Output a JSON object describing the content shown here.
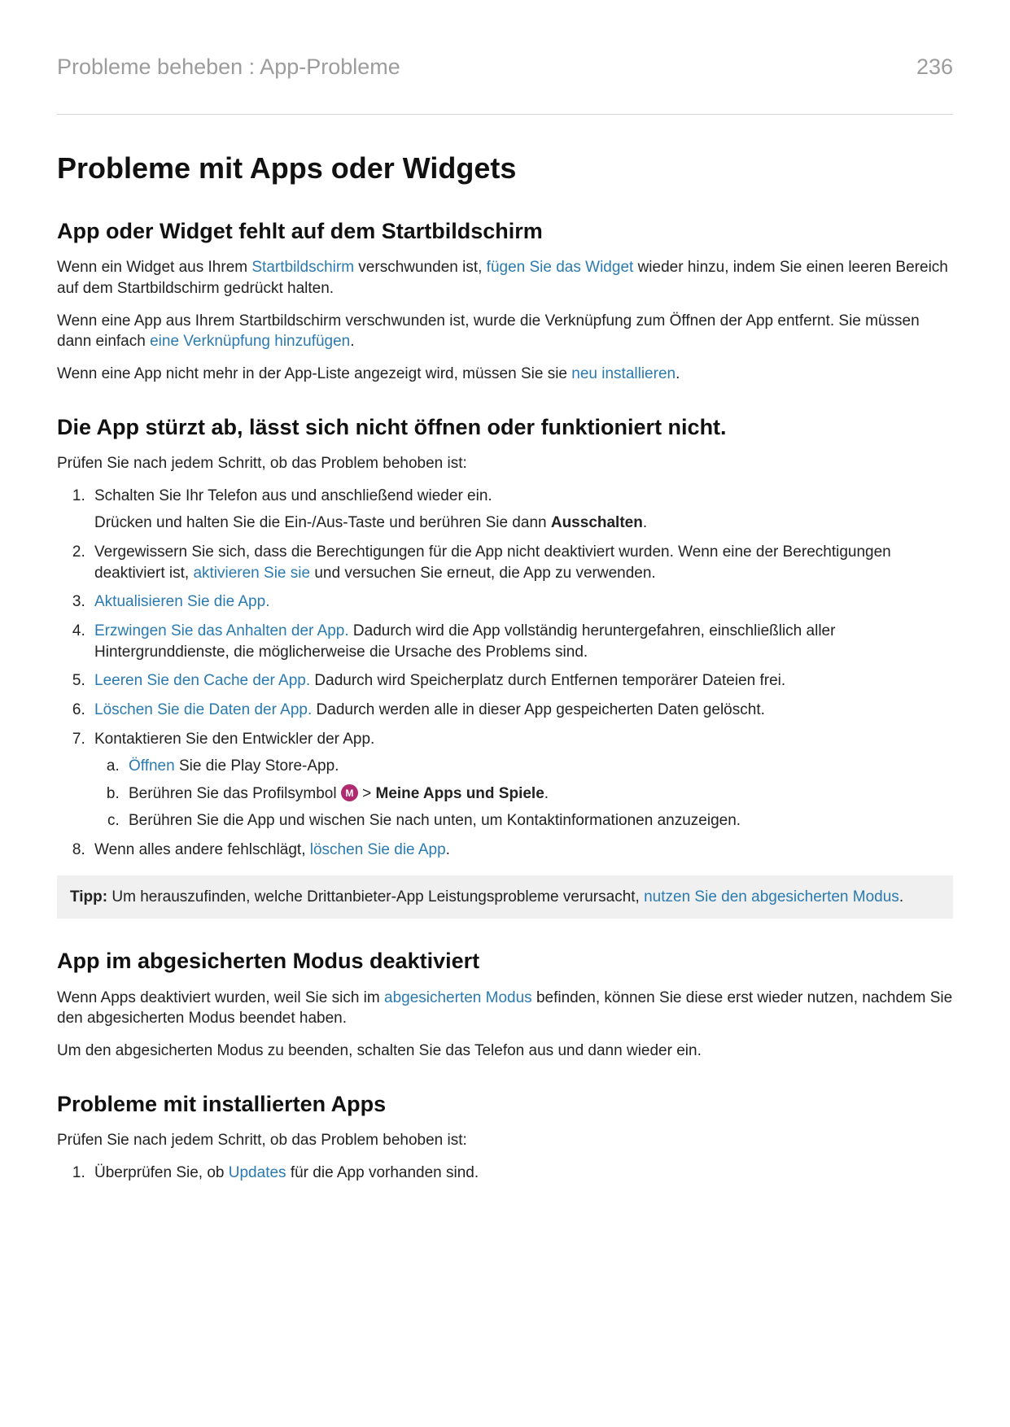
{
  "header": {
    "breadcrumb": "Probleme beheben : App-Probleme",
    "page_number": "236"
  },
  "title": "Probleme mit Apps oder Widgets",
  "s1": {
    "heading": "App oder Widget fehlt auf dem Startbildschirm",
    "p1_a": "Wenn ein Widget aus Ihrem ",
    "p1_link1": "Startbildschirm",
    "p1_b": " verschwunden ist, ",
    "p1_link2": "fügen Sie das Widget",
    "p1_c": " wieder hinzu, indem Sie einen leeren Bereich auf dem Startbildschirm gedrückt halten.",
    "p2_a": "Wenn eine App aus Ihrem Startbildschirm verschwunden ist, wurde die Verknüpfung zum Öffnen der App entfernt. Sie müssen dann einfach ",
    "p2_link": "eine Verknüpfung hinzufügen",
    "p2_b": ".",
    "p3_a": "Wenn eine App nicht mehr in der App-Liste angezeigt wird, müssen Sie sie ",
    "p3_link": "neu installieren",
    "p3_b": "."
  },
  "s2": {
    "heading": "Die App stürzt ab, lässt sich nicht öffnen oder funktioniert nicht.",
    "intro": "Prüfen Sie nach jedem Schritt, ob das Problem behoben ist:",
    "li1_p1": "Schalten Sie Ihr Telefon aus und anschließend wieder ein.",
    "li1_p2_a": "Drücken und halten Sie die Ein-/Aus-Taste und berühren Sie dann ",
    "li1_p2_bold": "Ausschalten",
    "li1_p2_b": ".",
    "li2_a": "Vergewissern Sie sich, dass die Berechtigungen für die App nicht deaktiviert wurden. Wenn eine der Berechtigungen deaktiviert ist, ",
    "li2_link": "aktivieren Sie sie",
    "li2_b": " und versuchen Sie erneut, die App zu verwenden.",
    "li3_link": "Aktualisieren Sie die App.",
    "li4_link": "Erzwingen Sie das Anhalten der App.",
    "li4_b": " Dadurch wird die App vollständig heruntergefahren, einschließlich aller Hintergrunddienste, die möglicherweise die Ursache des Problems sind.",
    "li5_link": "Leeren Sie den Cache der App.",
    "li5_b": " Dadurch wird Speicherplatz durch Entfernen temporärer Dateien frei.",
    "li6_link": "Löschen Sie die Daten der App.",
    "li6_b": " Dadurch werden alle in dieser App gespeicherten Daten gelöscht.",
    "li7_text": "Kontaktieren Sie den Entwickler der App.",
    "li7a_link": "Öffnen",
    "li7a_b": " Sie die Play Store-App.",
    "li7b_a": "Berühren Sie das Profilsymbol ",
    "li7b_icon_letter": "M",
    "li7b_mid": " > ",
    "li7b_bold": "Meine Apps und Spiele",
    "li7b_end": ".",
    "li7c": "Berühren Sie die App und wischen Sie nach unten, um Kontaktinformationen anzuzeigen.",
    "li8_a": "Wenn alles andere fehlschlägt, ",
    "li8_link": "löschen Sie die App",
    "li8_b": ".",
    "tip_label": "Tipp:",
    "tip_a": " Um herauszufinden, welche Drittanbieter-App Leistungsprobleme verursacht, ",
    "tip_link": "nutzen Sie den abgesicherten Modus",
    "tip_b": "."
  },
  "s3": {
    "heading": "App im abgesicherten Modus deaktiviert",
    "p1_a": "Wenn Apps deaktiviert wurden, weil Sie sich im ",
    "p1_link": "abgesicherten Modus",
    "p1_b": " befinden, können Sie diese erst wieder nutzen, nachdem Sie den abgesicherten Modus beendet haben.",
    "p2": "Um den abgesicherten Modus zu beenden, schalten Sie das Telefon aus und dann wieder ein."
  },
  "s4": {
    "heading": "Probleme mit installierten Apps",
    "intro": "Prüfen Sie nach jedem Schritt, ob das Problem behoben ist:",
    "li1_a": "Überprüfen Sie, ob ",
    "li1_link": "Updates",
    "li1_b": " für die App vorhanden sind."
  }
}
